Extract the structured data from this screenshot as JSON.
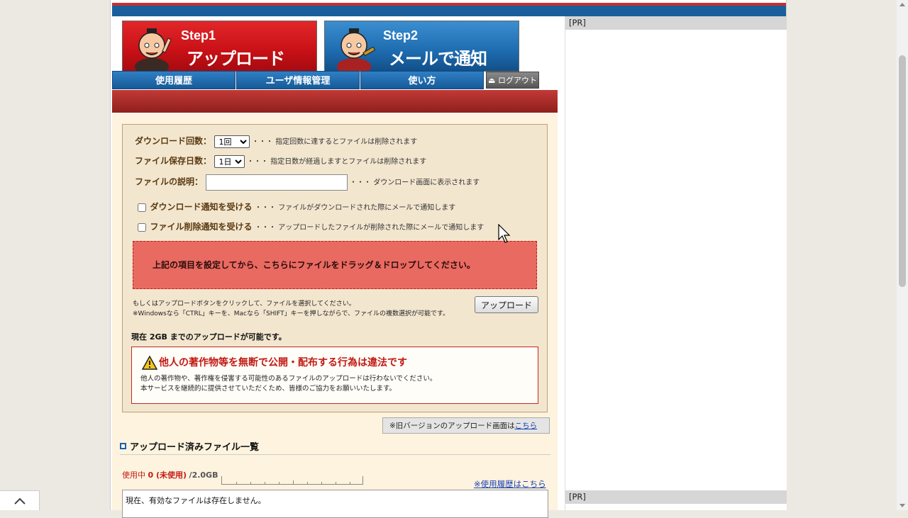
{
  "header": {
    "step1": {
      "number": "Step1",
      "title": "アップロード"
    },
    "step2": {
      "number": "Step2",
      "title": "メールで通知"
    }
  },
  "nav": {
    "items": [
      {
        "label": "使用履歴"
      },
      {
        "label": "ユーザ情報管理"
      },
      {
        "label": "使い方"
      }
    ],
    "logout_label": "ログアウト"
  },
  "form": {
    "download_count": {
      "label": "ダウンロード回数：",
      "value": "1回",
      "note": "・・・ 指定回数に達するとファイルは削除されます"
    },
    "retention_days": {
      "label": "ファイル保存日数：",
      "value": "1日",
      "note": "・・・ 指定日数が経過しますとファイルは削除されます"
    },
    "description": {
      "label": "ファイルの説明：",
      "value": "",
      "note": "・・・ ダウンロード画面に表示されます"
    },
    "download_notify": {
      "label": "ダウンロード通知を受ける",
      "checked": false,
      "note": "・・・ ファイルがダウンロードされた際にメールで通知します"
    },
    "delete_notify": {
      "label": "ファイル削除通知を受ける",
      "checked": false,
      "note": "・・・ アップロードしたファイルが削除された際にメールで通知します"
    },
    "dropzone_text": "上記の項目を設定してから、こちらにファイルをドラッグ＆ドロップしてください。",
    "help_line1": "もしくはアップロードボタンをクリックして、ファイルを選択してください。",
    "help_line2": "※Windowsなら「CTRL」キーを、Macなら「SHIFT」キーを押しながらで、ファイルの複数選択が可能です。",
    "upload_button": "アップロード",
    "capacity_text": "現在 2GB までのアップロードが可能です。",
    "warning": {
      "title": "他人の著作物等を無断で公開・配布する行為は違法です",
      "line1": "他人の著作物や、著作権を侵害する可能性のあるファイルのアップロードは行わないでください。",
      "line2": "本サービスを継続的に提供させていただくため、皆様のご協力をお願いいたします。"
    }
  },
  "old_version": {
    "text": "※旧バージョンのアップロード画面は",
    "link": "こちら"
  },
  "files_section": {
    "title": "アップロード済みファイル一覧",
    "usage_label": "使用中",
    "usage_value": "0 (未使用)",
    "usage_total": "/2.0GB",
    "usage_fraction": 0,
    "history_link": "※使用履歴はこちら",
    "empty_text": "現在、有効なファイルは存在しません。"
  },
  "sidebar": {
    "pr_label_top": "[PR]",
    "pr_label_bottom": "[PR]"
  }
}
